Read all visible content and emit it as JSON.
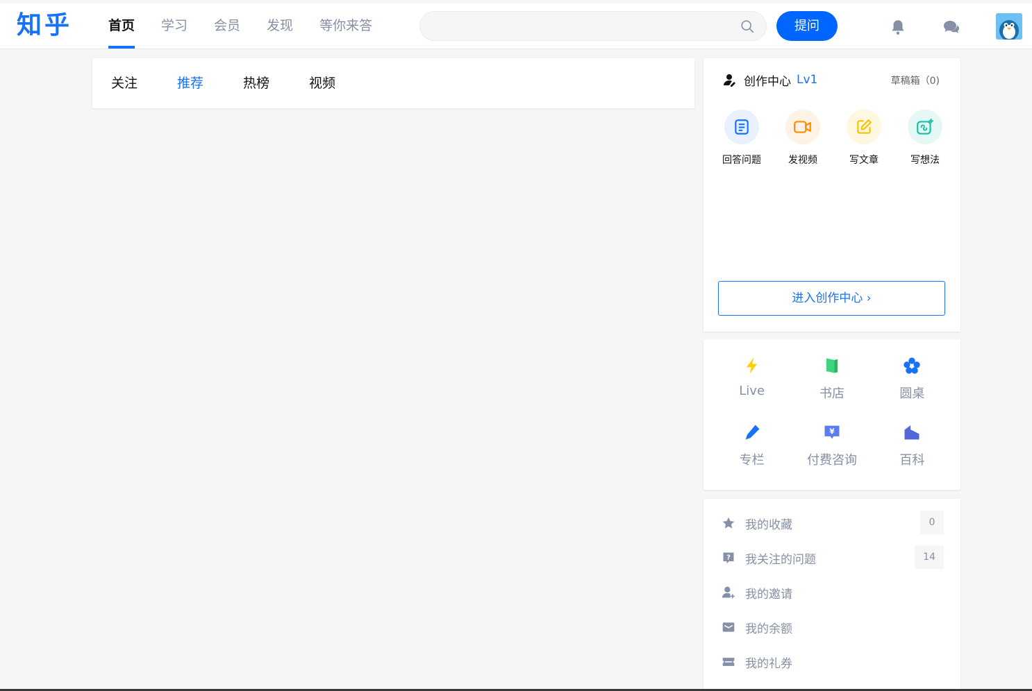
{
  "header": {
    "logo": "知乎",
    "nav": [
      {
        "label": "首页",
        "active": true
      },
      {
        "label": "学习",
        "active": false
      },
      {
        "label": "会员",
        "active": false
      },
      {
        "label": "发现",
        "active": false
      },
      {
        "label": "等你来答",
        "active": false
      }
    ],
    "search": {
      "placeholder": "",
      "value": ""
    },
    "ask_label": "提问",
    "accent": "#1772f6"
  },
  "feed_tabs": [
    {
      "label": "关注",
      "active": false
    },
    {
      "label": "推荐",
      "active": true
    },
    {
      "label": "热榜",
      "active": false
    },
    {
      "label": "视频",
      "active": false
    }
  ],
  "creator": {
    "title": "创作中心",
    "level": "Lv1",
    "drafts": "草稿箱（0)",
    "actions": [
      {
        "label": "回答问题",
        "icon": "answer-icon",
        "color": "#1772f6",
        "bg": "#e9f1fe"
      },
      {
        "label": "发视频",
        "icon": "video-icon",
        "color": "#ff8a00",
        "bg": "#fff3e5"
      },
      {
        "label": "写文章",
        "icon": "pencil-icon",
        "color": "#f5c200",
        "bg": "#fff8e0"
      },
      {
        "label": "写想法",
        "icon": "thought-icon",
        "color": "#15c0a8",
        "bg": "#e5f8f5"
      }
    ],
    "enter_label": "进入创作中心 ›"
  },
  "services": [
    {
      "label": "Live",
      "icon": "lightning-icon",
      "color": "#ffcf00"
    },
    {
      "label": "书店",
      "icon": "book-icon",
      "color": "#3cd47c"
    },
    {
      "label": "圆桌",
      "icon": "pinwheel-icon",
      "color": "#1772f6"
    },
    {
      "label": "专栏",
      "icon": "column-pen-icon",
      "color": "#1772f6"
    },
    {
      "label": "付费咨询",
      "icon": "consult-icon",
      "color": "#5b7bf1"
    },
    {
      "label": "百科",
      "icon": "wiki-icon",
      "color": "#5368d9"
    }
  ],
  "mine": [
    {
      "label": "我的收藏",
      "icon": "star-icon",
      "count": "0"
    },
    {
      "label": "我关注的问题",
      "icon": "question-icon",
      "count": "14"
    },
    {
      "label": "我的邀请",
      "icon": "invite-icon",
      "count": ""
    },
    {
      "label": "我的余额",
      "icon": "wallet-icon",
      "count": ""
    },
    {
      "label": "我的礼券",
      "icon": "coupon-icon",
      "count": ""
    }
  ]
}
